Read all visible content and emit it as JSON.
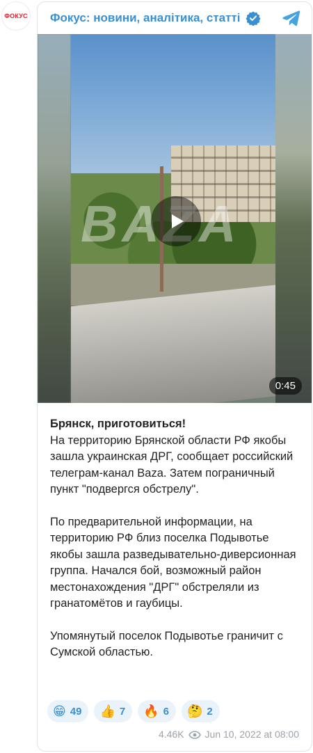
{
  "avatar": {
    "label": "ФОКУС",
    "icon": "channel-avatar"
  },
  "header": {
    "channel_name": "Фокус: новини, аналітика, статті",
    "verified_icon": "verified-badge-icon",
    "app_icon": "telegram-icon",
    "accent_color": "#3a8fd0"
  },
  "video": {
    "duration": "0:45",
    "watermark": "BAZA",
    "play_icon": "play-icon"
  },
  "post": {
    "title": "Брянск, приготовиться!",
    "paragraph1": "На территорию Брянской области РФ якобы зашла украинская ДРГ, сообщает российский телеграм-канал Baza. Затем пограничный пункт \"подвергся обстрелу\".",
    "paragraph2": "По предварительной информации, на территорию РФ близ поселка Подывотье якобы зашла разведывательно-диверсионная группа. Начался бой, возможный район местонахождения \"ДРГ\" обстреляли из гранатомётов и гаубицы.",
    "paragraph3": "Упомянутый поселок Подывотье граничит с Сумской областью."
  },
  "reactions": [
    {
      "emoji": "😁",
      "count": "49"
    },
    {
      "emoji": "👍",
      "count": "7"
    },
    {
      "emoji": "🔥",
      "count": "6"
    },
    {
      "emoji": "🤔",
      "count": "2"
    }
  ],
  "footer": {
    "views": "4.46K",
    "views_icon": "eye-icon",
    "date": "Jun 10, 2022 at 08:00"
  }
}
